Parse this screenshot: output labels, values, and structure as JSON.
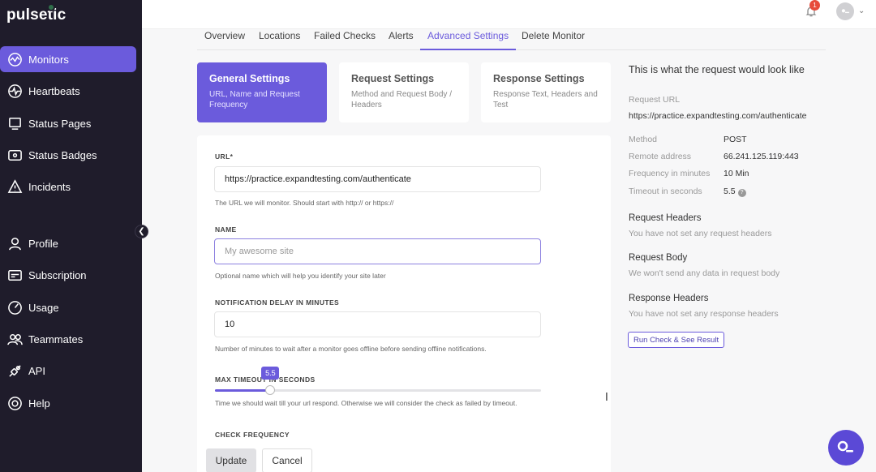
{
  "brand": {
    "name": "pulsetic"
  },
  "sidebar": {
    "items": [
      {
        "label": "Monitors",
        "icon": "monitors-icon",
        "active": true
      },
      {
        "label": "Heartbeats",
        "icon": "heartbeat-icon"
      },
      {
        "label": "Status Pages",
        "icon": "status-pages-icon"
      },
      {
        "label": "Status Badges",
        "icon": "status-badges-icon"
      },
      {
        "label": "Incidents",
        "icon": "incidents-icon"
      },
      {
        "label": "Profile",
        "icon": "profile-icon"
      },
      {
        "label": "Subscription",
        "icon": "subscription-icon"
      },
      {
        "label": "Usage",
        "icon": "usage-icon"
      },
      {
        "label": "Teammates",
        "icon": "teammates-icon"
      },
      {
        "label": "API",
        "icon": "api-icon"
      },
      {
        "label": "Help",
        "icon": "help-icon"
      }
    ]
  },
  "topbar": {
    "notification_count": "1"
  },
  "tabs": [
    {
      "label": "Overview"
    },
    {
      "label": "Locations"
    },
    {
      "label": "Failed Checks"
    },
    {
      "label": "Alerts"
    },
    {
      "label": "Advanced Settings",
      "active": true
    },
    {
      "label": "Delete Monitor"
    }
  ],
  "setting_cards": [
    {
      "title": "General Settings",
      "desc": "URL, Name and Request Frequency",
      "active": true
    },
    {
      "title": "Request Settings",
      "desc": "Method and Request Body / Headers"
    },
    {
      "title": "Response Settings",
      "desc": "Response Text, Headers and Test"
    }
  ],
  "form": {
    "url_label": "URL*",
    "url_value": "https://practice.expandtesting.com/authenticate",
    "url_help": "The URL we will monitor. Should start with http:// or https://",
    "name_label": "NAME",
    "name_placeholder": "My awesome site",
    "name_help": "Optional name which will help you identify your site later",
    "delay_label": "NOTIFICATION DELAY IN MINUTES",
    "delay_value": "10",
    "delay_help": "Number of minutes to wait after a monitor goes offline before sending offline notifications.",
    "timeout_label": "MAX TIMEOUT IN SECONDS",
    "timeout_value": "5.5",
    "timeout_fraction": 0.17,
    "timeout_help": "Time we should wait till your url respond. Otherwise we will consider the check as failed by timeout.",
    "frequency_label": "CHECK FREQUENCY",
    "update_label": "Update",
    "cancel_label": "Cancel"
  },
  "preview": {
    "title": "This is what the request would look like",
    "request_url_label": "Request URL",
    "request_url": "https://practice.expandtesting.com/authenticate",
    "rows": [
      {
        "label": "Method",
        "value": "POST"
      },
      {
        "label": "Remote address",
        "value": "66.241.125.119:443"
      },
      {
        "label": "Frequency in minutes",
        "value": "10 Min"
      },
      {
        "label": "Timeout in seconds",
        "value": "5.5"
      }
    ],
    "request_headers_title": "Request Headers",
    "request_headers_text": "You have not set any request headers",
    "request_body_title": "Request Body",
    "request_body_text": "We won't send any data in request body",
    "response_headers_title": "Response Headers",
    "response_headers_text": "You have not set any response headers",
    "run_button": "Run Check & See Result"
  },
  "colors": {
    "accent": "#6b5bdc",
    "sidebar": "#1f1c2b",
    "badge": "#e74c3c"
  }
}
